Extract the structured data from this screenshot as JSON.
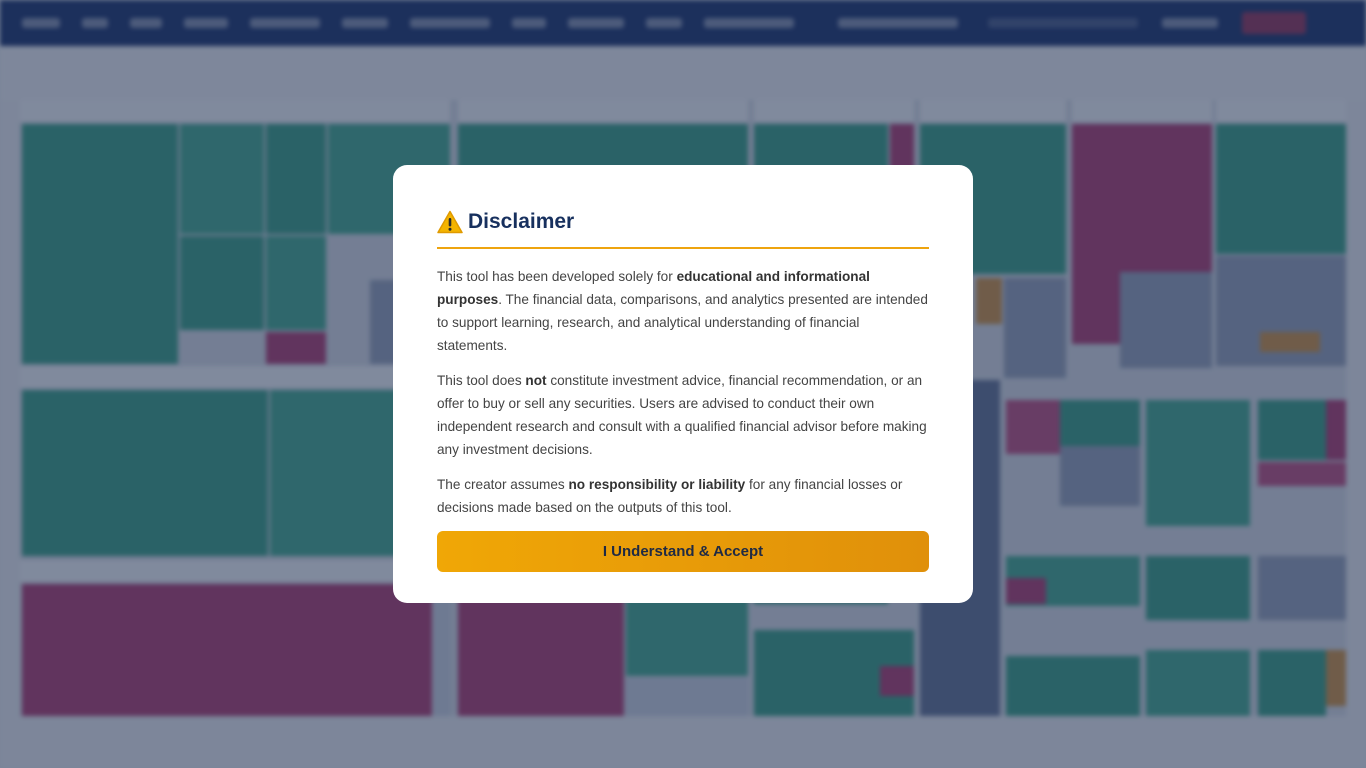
{
  "disclaimer": {
    "title": "Disclaimer",
    "icon": "warning-icon",
    "p1": {
      "before": "This tool has been developed solely for ",
      "bold": "educational and informational purposes",
      "after": ". The financial data, comparisons, and analytics presented are intended to support learning, research, and analytical understanding of financial statements."
    },
    "p2": {
      "before": "This tool does ",
      "bold": "not",
      "after": " constitute investment advice, financial recommendation, or an offer to buy or sell any securities. Users are advised to conduct their own independent research and consult with a qualified financial advisor before making any investment decisions."
    },
    "p3": {
      "before": "The creator assumes ",
      "bold": "no responsibility or liability",
      "after": " for any financial losses or decisions made based on the outputs of this tool."
    },
    "accept_label": "I Understand & Accept"
  },
  "colors": {
    "accent": "#eea40f",
    "title": "#17305e",
    "header_bg": "#102a66",
    "gain": "#2f9a7f",
    "loss": "#a8336a"
  }
}
